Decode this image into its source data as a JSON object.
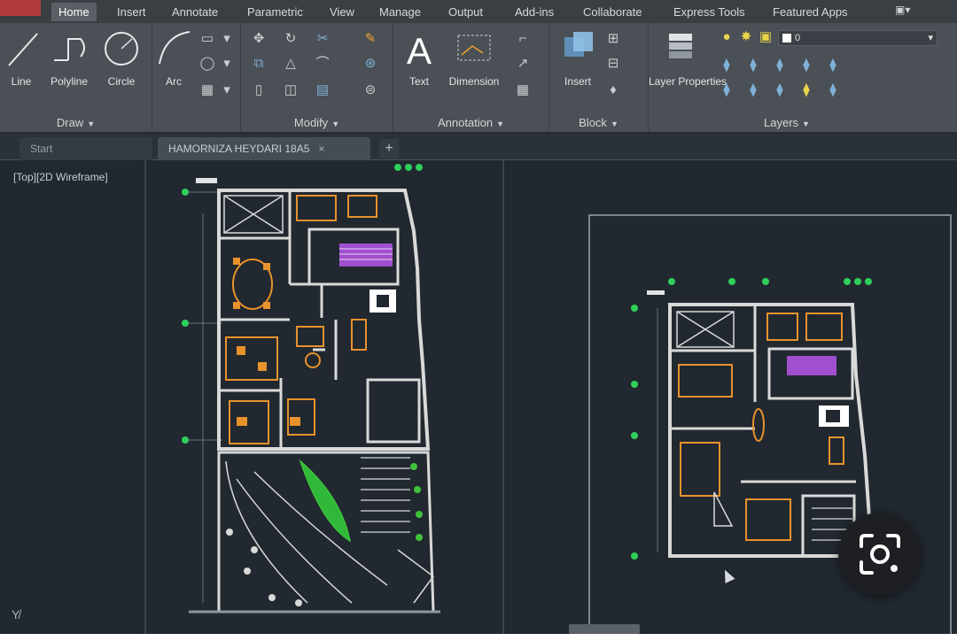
{
  "ribbon_tabs": [
    "Home",
    "Insert",
    "Annotate",
    "Parametric",
    "View",
    "Manage",
    "Output",
    "Add-ins",
    "Collaborate",
    "Express Tools",
    "Featured Apps"
  ],
  "active_tab": "Home",
  "draw_panel": {
    "title": "Draw",
    "tools": [
      "Line",
      "Polyline",
      "Circle",
      "Arc"
    ]
  },
  "modify_panel": {
    "title": "Modify"
  },
  "annotation_panel": {
    "title": "Annotation",
    "tools": [
      "Text",
      "Dimension"
    ]
  },
  "block_panel": {
    "title": "Block",
    "tools": [
      "Insert"
    ]
  },
  "layers_panel": {
    "title": "Layers",
    "tools": [
      "Layer Properties"
    ],
    "current_layer": "0"
  },
  "doc_tabs": {
    "start": "Start",
    "active_file": "HAMORNIZA HEYDARI 18A5"
  },
  "viewport_label": "[Top][2D Wireframe]",
  "icons": {
    "lens": "google-lens-icon",
    "ucs": "ucs-icon"
  },
  "colors": {
    "model_background": "#212830",
    "ribbon_background": "#4a5055",
    "wall_color": "#d9d9d9",
    "furniture_color": "#e8922c",
    "landscape_color": "#3fc43a",
    "accent_magenta": "#a04fcf"
  }
}
